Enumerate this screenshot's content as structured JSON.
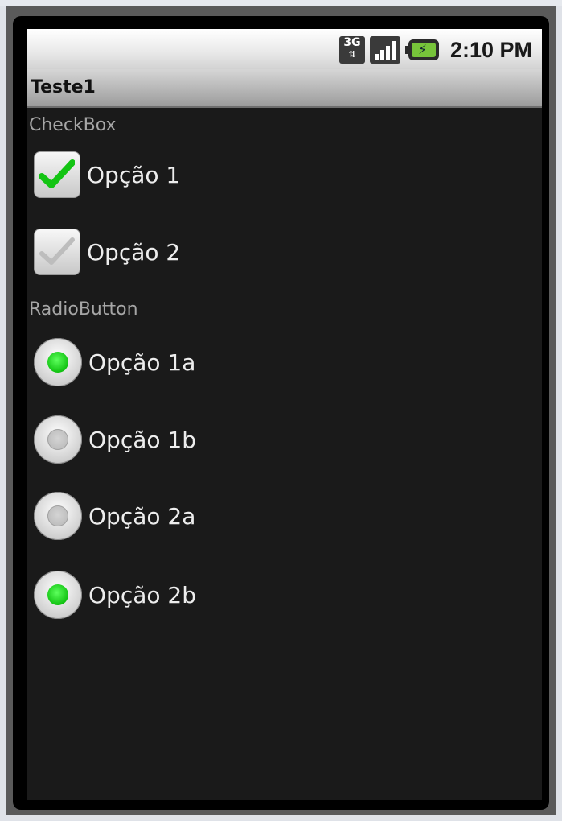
{
  "status_bar": {
    "network": "3G",
    "time": "2:10 PM"
  },
  "app": {
    "title": "Teste1"
  },
  "checkbox_section": {
    "label": "CheckBox",
    "items": [
      {
        "label": "Opção 1",
        "checked": true
      },
      {
        "label": "Opção 2",
        "checked": false
      }
    ]
  },
  "radio_section": {
    "label": "RadioButton",
    "items": [
      {
        "label": "Opção 1a",
        "selected": true
      },
      {
        "label": "Opção 1b",
        "selected": false
      },
      {
        "label": "Opção 2a",
        "selected": false
      },
      {
        "label": "Opção 2b",
        "selected": true
      }
    ]
  },
  "colors": {
    "accent_green": "#13c413",
    "screen_background": "#1a1a1a"
  }
}
